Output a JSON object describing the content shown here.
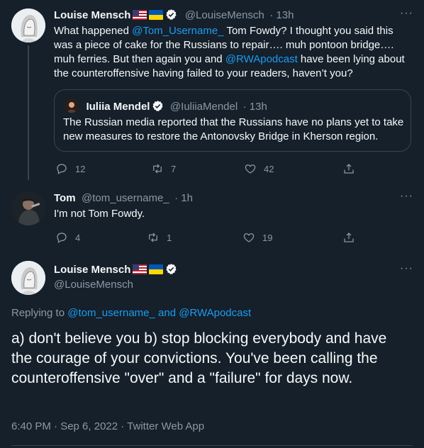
{
  "tweet1": {
    "name": "Louise Mensch",
    "handle": "@LouiseMensch",
    "time": "· 13h",
    "text_part1": "What happened ",
    "mention1": "@Tom_Username_",
    "text_part2": " Tom Fowdy? I thought you said this was a piece of cake for the Russians to repair…. muh pontoon bridge…. muh ferries. But then again you and ",
    "mention2": "@RWApodcast",
    "text_part3": " have been lying about the counteroffensive having failed to your readers, haven’t you?",
    "reply_count": "12",
    "retweet_count": "7",
    "like_count": "42"
  },
  "quote": {
    "name": "Iuliia Mendel",
    "handle": "@IuliiaMendel",
    "time": "· 13h",
    "text": "The Russian media reported that the Russians have no plans yet to take new measures to restore the Antonovsky Bridge in Kherson region."
  },
  "tweet2": {
    "name": "Tom",
    "handle": "@tom_username_",
    "time": "· 1h",
    "text": "I'm not Tom Fowdy.",
    "reply_count": "4",
    "retweet_count": "1",
    "like_count": "19"
  },
  "main": {
    "name": "Louise Mensch",
    "handle": "@LouiseMensch",
    "replying_prefix": "Replying to ",
    "replying_user1": "@tom_username_",
    "replying_and": " and ",
    "replying_user2": "@RWApodcast",
    "text": "a) don't believe you b) stop blocking everybody and have the courage of your convictions. You've been calling the counteroffensive \"over\" and a \"failure\" for days now.",
    "timestamp": "6:40 PM · Sep 6, 2022 · Twitter Web App"
  },
  "icons": [
    "more-dots-icon",
    "reply-icon",
    "retweet-icon",
    "like-icon",
    "share-icon",
    "verified-badge-icon",
    "us-flag-icon",
    "ukraine-flag-icon"
  ],
  "colors": {
    "background": "#15202b",
    "accent": "#1d9bf0",
    "muted": "#8b98a5",
    "border": "#38444d"
  }
}
